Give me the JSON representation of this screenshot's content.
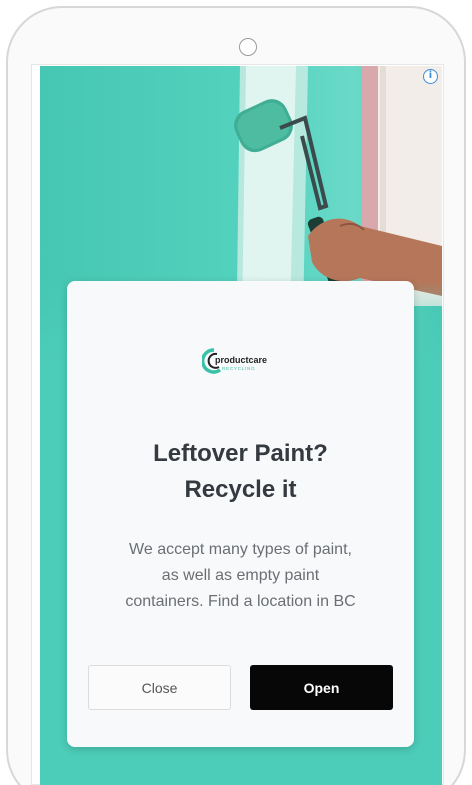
{
  "ad": {
    "brand": {
      "name": "productcare",
      "sub": "RECYCLING"
    },
    "headline_line1": "Leftover Paint?",
    "headline_line2": "Recycle it",
    "body_line1": "We accept many types of paint,",
    "body_line2": "as well as empty paint",
    "body_line3": "containers. Find a location in BC",
    "close_label": "Close",
    "open_label": "Open",
    "accent_color": "#4ccdb9"
  },
  "icons": {
    "info": "info-icon",
    "camera": "camera-icon"
  }
}
